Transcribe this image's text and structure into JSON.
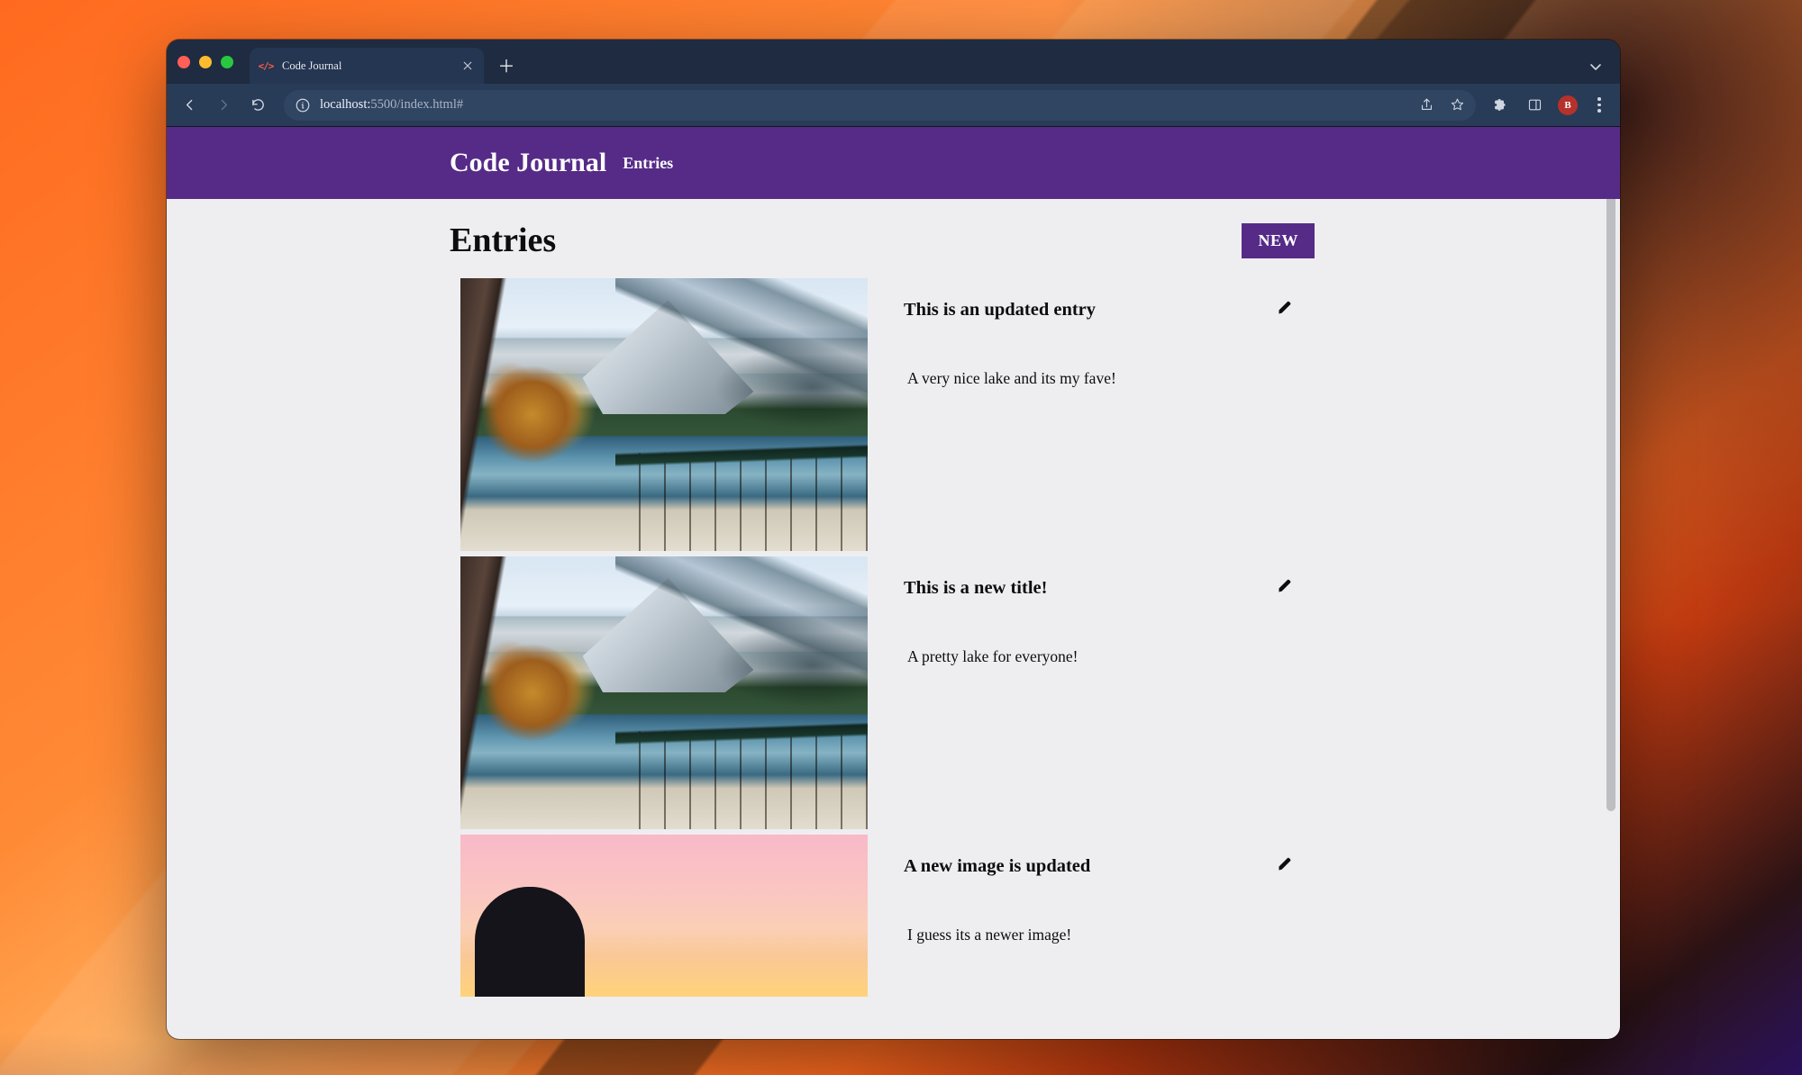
{
  "browser": {
    "tab_title": "Code Journal",
    "favicon_text": "</>",
    "url_display_host": "localhost:",
    "url_display_port_path": "5500/index.html#",
    "avatar_initial": "B"
  },
  "header": {
    "brand": "Code Journal",
    "nav_entries": "Entries"
  },
  "entries_section": {
    "heading": "Entries",
    "new_button": "NEW"
  },
  "entries": [
    {
      "title": "This is an updated entry",
      "body": "A very nice lake and its my fave!",
      "image_kind": "lake"
    },
    {
      "title": "This is a new title!",
      "body": "A pretty lake for everyone!",
      "image_kind": "lake"
    },
    {
      "title": "A new image is updated",
      "body": "I guess its a newer image!",
      "image_kind": "sunset"
    }
  ]
}
